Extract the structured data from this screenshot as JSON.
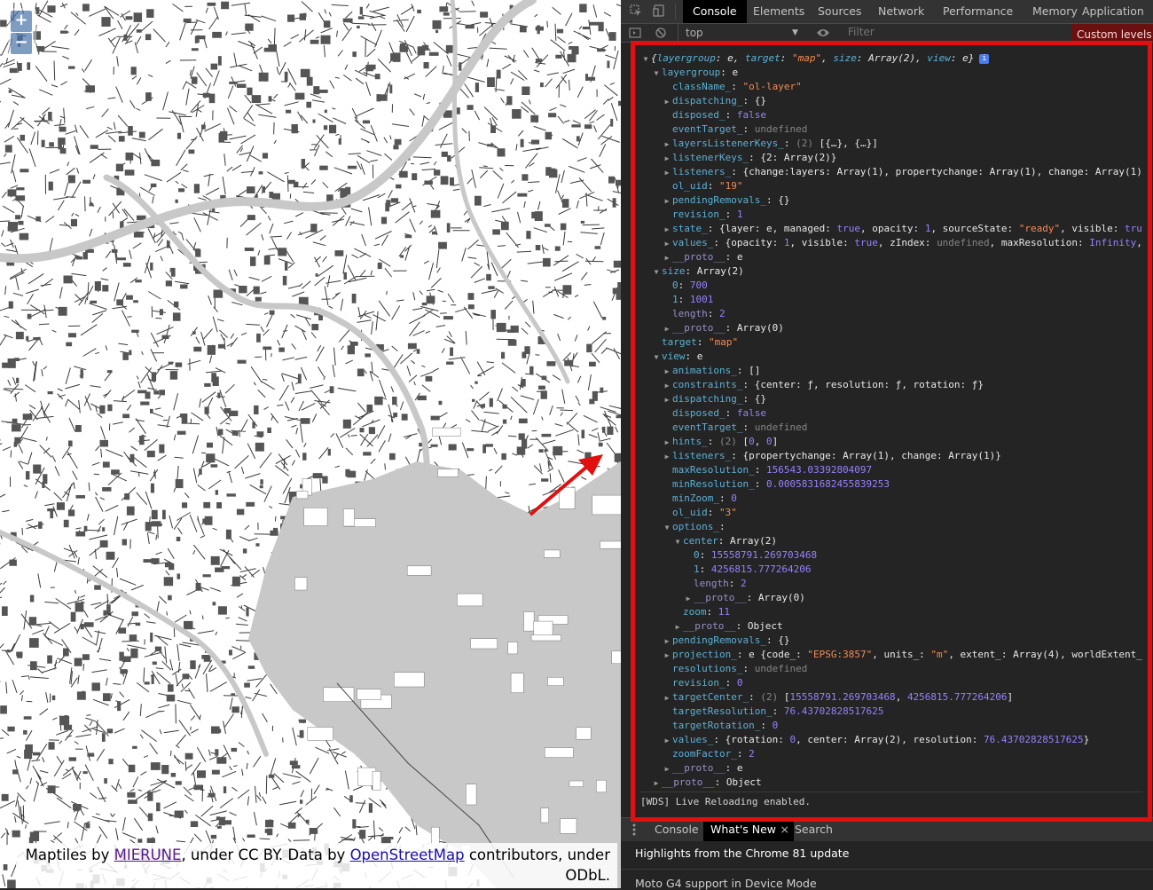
{
  "map": {
    "zoom_in": "+",
    "zoom_out": "−",
    "attribution": {
      "prefix": "Maptiles by ",
      "mierune": "MIERUNE",
      "mid": ", under CC BY. Data by ",
      "osm": "OpenStreetMap",
      "suffix": " contributors, under ODbL."
    }
  },
  "devtools": {
    "tabs": [
      "Console",
      "Elements",
      "Sources",
      "Network",
      "Performance",
      "Memory",
      "Application"
    ],
    "active_tab": "Console",
    "toolbar": {
      "context": "top",
      "filter_placeholder": "Filter",
      "levels": "Custom levels ▾"
    },
    "drawer_tabs": [
      "Console",
      "What's New",
      "Search"
    ],
    "drawer_active": "What's New",
    "drawer_close": "×",
    "drawer_headline": "Highlights from the Chrome 81 update",
    "drawer_next": "Moto G4 support in Device Mode",
    "wds_message": "[WDS] Live Reloading enabled.",
    "icons": {
      "inspect": "inspect-element-icon",
      "device": "device-toolbar-icon",
      "sidebar": "sidebar-toggle-icon",
      "clear": "clear-console-icon",
      "eye": "live-expression-icon",
      "drawer_menu": "drawer-menu-icon"
    },
    "highlight_color": "#e01010"
  },
  "console_tree": [
    {
      "indent": 0,
      "tri": "down",
      "segs": [
        [
          "p",
          "{"
        ],
        [
          "k",
          "layergroup"
        ],
        [
          "p",
          ": e, "
        ],
        [
          "k",
          "target"
        ],
        [
          "p",
          ": "
        ],
        [
          "s",
          "\"map\""
        ],
        [
          "p",
          ", "
        ],
        [
          "k",
          "size"
        ],
        [
          "p",
          ": Array(2), "
        ],
        [
          "k",
          "view"
        ],
        [
          "p",
          ": e}"
        ]
      ]
    },
    {
      "indent": 1,
      "tri": "down",
      "segs": [
        [
          "k",
          "layergroup"
        ],
        [
          "p",
          ": e"
        ]
      ]
    },
    {
      "indent": 2,
      "tri": "",
      "segs": [
        [
          "k",
          "className_"
        ],
        [
          "p",
          ": "
        ],
        [
          "s",
          "\"ol-layer\""
        ]
      ]
    },
    {
      "indent": 2,
      "tri": "right",
      "segs": [
        [
          "k",
          "dispatching_"
        ],
        [
          "p",
          ": {}"
        ]
      ]
    },
    {
      "indent": 2,
      "tri": "",
      "segs": [
        [
          "k",
          "disposed_"
        ],
        [
          "p",
          ": "
        ],
        [
          "b",
          "false"
        ]
      ]
    },
    {
      "indent": 2,
      "tri": "",
      "segs": [
        [
          "k",
          "eventTarget_"
        ],
        [
          "p",
          ": "
        ],
        [
          "u",
          "undefined"
        ]
      ]
    },
    {
      "indent": 2,
      "tri": "right",
      "segs": [
        [
          "k",
          "layersListenerKeys_"
        ],
        [
          "p",
          ": "
        ],
        [
          "u",
          "(2) "
        ],
        [
          "p",
          "[{…}, {…}]"
        ]
      ]
    },
    {
      "indent": 2,
      "tri": "right",
      "segs": [
        [
          "k",
          "listenerKeys_"
        ],
        [
          "p",
          ": {2: Array(2)}"
        ]
      ]
    },
    {
      "indent": 2,
      "tri": "right",
      "segs": [
        [
          "k",
          "listeners_"
        ],
        [
          "p",
          ": {change:layers: Array(1), propertychange: Array(1), change: Array(1)}"
        ]
      ]
    },
    {
      "indent": 2,
      "tri": "",
      "segs": [
        [
          "k",
          "ol_uid"
        ],
        [
          "p",
          ": "
        ],
        [
          "s",
          "\"19\""
        ]
      ]
    },
    {
      "indent": 2,
      "tri": "right",
      "segs": [
        [
          "k",
          "pendingRemovals_"
        ],
        [
          "p",
          ": {}"
        ]
      ]
    },
    {
      "indent": 2,
      "tri": "",
      "segs": [
        [
          "k",
          "revision_"
        ],
        [
          "p",
          ": "
        ],
        [
          "n",
          "1"
        ]
      ]
    },
    {
      "indent": 2,
      "tri": "right",
      "segs": [
        [
          "k",
          "state_"
        ],
        [
          "p",
          ": {layer: e, managed: "
        ],
        [
          "b",
          "true"
        ],
        [
          "p",
          ", opacity: "
        ],
        [
          "n",
          "1"
        ],
        [
          "p",
          ", sourceState: "
        ],
        [
          "s",
          "\"ready\""
        ],
        [
          "p",
          ", visible: "
        ],
        [
          "b",
          "true"
        ],
        [
          "p",
          ", …}"
        ]
      ]
    },
    {
      "indent": 2,
      "tri": "right",
      "segs": [
        [
          "k",
          "values_"
        ],
        [
          "p",
          ": {opacity: "
        ],
        [
          "n",
          "1"
        ],
        [
          "p",
          ", visible: "
        ],
        [
          "b",
          "true"
        ],
        [
          "p",
          ", zIndex: "
        ],
        [
          "u",
          "undefined"
        ],
        [
          "p",
          ", maxResolution: "
        ],
        [
          "n",
          "Infinity"
        ],
        [
          "p",
          ", minResolution: 0}"
        ]
      ]
    },
    {
      "indent": 2,
      "tri": "right",
      "segs": [
        [
          "k dim",
          "__proto__"
        ],
        [
          "p",
          ": e"
        ]
      ]
    },
    {
      "indent": 1,
      "tri": "down",
      "segs": [
        [
          "k",
          "size"
        ],
        [
          "p",
          ": Array(2)"
        ]
      ]
    },
    {
      "indent": 2,
      "tri": "",
      "segs": [
        [
          "k",
          "0"
        ],
        [
          "p",
          ": "
        ],
        [
          "n",
          "700"
        ]
      ]
    },
    {
      "indent": 2,
      "tri": "",
      "segs": [
        [
          "k",
          "1"
        ],
        [
          "p",
          ": "
        ],
        [
          "n",
          "1001"
        ]
      ]
    },
    {
      "indent": 2,
      "tri": "",
      "segs": [
        [
          "k dim",
          "length"
        ],
        [
          "p",
          ": "
        ],
        [
          "n",
          "2"
        ]
      ]
    },
    {
      "indent": 2,
      "tri": "right",
      "segs": [
        [
          "k dim",
          "__proto__"
        ],
        [
          "p",
          ": Array(0)"
        ]
      ]
    },
    {
      "indent": 1,
      "tri": "",
      "segs": [
        [
          "k",
          "target"
        ],
        [
          "p",
          ": "
        ],
        [
          "s",
          "\"map\""
        ]
      ]
    },
    {
      "indent": 1,
      "tri": "down",
      "segs": [
        [
          "k",
          "view"
        ],
        [
          "p",
          ": e"
        ]
      ]
    },
    {
      "indent": 2,
      "tri": "right",
      "segs": [
        [
          "k",
          "animations_"
        ],
        [
          "p",
          ": []"
        ]
      ]
    },
    {
      "indent": 2,
      "tri": "right",
      "segs": [
        [
          "k",
          "constraints_"
        ],
        [
          "p",
          ": {center: "
        ],
        [
          "p",
          "ƒ"
        ],
        [
          "p",
          ", resolution: "
        ],
        [
          "p",
          "ƒ"
        ],
        [
          "p",
          ", rotation: "
        ],
        [
          "p",
          "ƒ"
        ],
        [
          "p",
          "}"
        ]
      ]
    },
    {
      "indent": 2,
      "tri": "right",
      "segs": [
        [
          "k",
          "dispatching_"
        ],
        [
          "p",
          ": {}"
        ]
      ]
    },
    {
      "indent": 2,
      "tri": "",
      "segs": [
        [
          "k",
          "disposed_"
        ],
        [
          "p",
          ": "
        ],
        [
          "b",
          "false"
        ]
      ]
    },
    {
      "indent": 2,
      "tri": "",
      "segs": [
        [
          "k",
          "eventTarget_"
        ],
        [
          "p",
          ": "
        ],
        [
          "u",
          "undefined"
        ]
      ]
    },
    {
      "indent": 2,
      "tri": "right",
      "segs": [
        [
          "k",
          "hints_"
        ],
        [
          "p",
          ": "
        ],
        [
          "u",
          "(2) "
        ],
        [
          "p",
          "["
        ],
        [
          "n",
          "0"
        ],
        [
          "p",
          ", "
        ],
        [
          "n",
          "0"
        ],
        [
          "p",
          "]"
        ]
      ]
    },
    {
      "indent": 2,
      "tri": "right",
      "segs": [
        [
          "k",
          "listeners_"
        ],
        [
          "p",
          ": {propertychange: Array(1), change: Array(1)}"
        ]
      ]
    },
    {
      "indent": 2,
      "tri": "",
      "segs": [
        [
          "k",
          "maxResolution_"
        ],
        [
          "p",
          ": "
        ],
        [
          "n",
          "156543.03392804097"
        ]
      ]
    },
    {
      "indent": 2,
      "tri": "",
      "segs": [
        [
          "k",
          "minResolution_"
        ],
        [
          "p",
          ": "
        ],
        [
          "n",
          "0.0005831682455839253"
        ]
      ]
    },
    {
      "indent": 2,
      "tri": "",
      "segs": [
        [
          "k",
          "minZoom_"
        ],
        [
          "p",
          ": "
        ],
        [
          "n",
          "0"
        ]
      ]
    },
    {
      "indent": 2,
      "tri": "",
      "segs": [
        [
          "k",
          "ol_uid"
        ],
        [
          "p",
          ": "
        ],
        [
          "s",
          "\"3\""
        ]
      ]
    },
    {
      "indent": 2,
      "tri": "down",
      "segs": [
        [
          "k",
          "options_"
        ],
        [
          "p",
          ":"
        ]
      ]
    },
    {
      "indent": 3,
      "tri": "down",
      "segs": [
        [
          "k",
          "center"
        ],
        [
          "p",
          ": Array(2)"
        ]
      ]
    },
    {
      "indent": 4,
      "tri": "",
      "segs": [
        [
          "k",
          "0"
        ],
        [
          "p",
          ": "
        ],
        [
          "n",
          "15558791.269703468"
        ]
      ]
    },
    {
      "indent": 4,
      "tri": "",
      "segs": [
        [
          "k",
          "1"
        ],
        [
          "p",
          ": "
        ],
        [
          "n",
          "4256815.777264206"
        ]
      ]
    },
    {
      "indent": 4,
      "tri": "",
      "segs": [
        [
          "k dim",
          "length"
        ],
        [
          "p",
          ": "
        ],
        [
          "n",
          "2"
        ]
      ]
    },
    {
      "indent": 4,
      "tri": "right",
      "segs": [
        [
          "k dim",
          "__proto__"
        ],
        [
          "p",
          ": Array(0)"
        ]
      ]
    },
    {
      "indent": 3,
      "tri": "",
      "segs": [
        [
          "k",
          "zoom"
        ],
        [
          "p",
          ": "
        ],
        [
          "n",
          "11"
        ]
      ]
    },
    {
      "indent": 3,
      "tri": "right",
      "segs": [
        [
          "k dim",
          "__proto__"
        ],
        [
          "p",
          ": Object"
        ]
      ]
    },
    {
      "indent": 2,
      "tri": "right",
      "segs": [
        [
          "k",
          "pendingRemovals_"
        ],
        [
          "p",
          ": {}"
        ]
      ]
    },
    {
      "indent": 2,
      "tri": "right",
      "segs": [
        [
          "k",
          "projection_"
        ],
        [
          "p",
          ": e {code_: "
        ],
        [
          "s",
          "\"EPSG:3857\""
        ],
        [
          "p",
          ", units_: "
        ],
        [
          "s",
          "\"m\""
        ],
        [
          "p",
          ", extent_: Array(4), worldExtent_: Array(4)…}"
        ]
      ]
    },
    {
      "indent": 2,
      "tri": "",
      "segs": [
        [
          "k",
          "resolutions_"
        ],
        [
          "p",
          ": "
        ],
        [
          "u",
          "undefined"
        ]
      ]
    },
    {
      "indent": 2,
      "tri": "",
      "segs": [
        [
          "k",
          "revision_"
        ],
        [
          "p",
          ": "
        ],
        [
          "n",
          "0"
        ]
      ]
    },
    {
      "indent": 2,
      "tri": "right",
      "segs": [
        [
          "k",
          "targetCenter_"
        ],
        [
          "p",
          ": "
        ],
        [
          "u",
          "(2) "
        ],
        [
          "p",
          "["
        ],
        [
          "n",
          "15558791.269703468"
        ],
        [
          "p",
          ", "
        ],
        [
          "n",
          "4256815.777264206"
        ],
        [
          "p",
          "]"
        ]
      ]
    },
    {
      "indent": 2,
      "tri": "",
      "segs": [
        [
          "k",
          "targetResolution_"
        ],
        [
          "p",
          ": "
        ],
        [
          "n",
          "76.43702828517625"
        ]
      ]
    },
    {
      "indent": 2,
      "tri": "",
      "segs": [
        [
          "k",
          "targetRotation_"
        ],
        [
          "p",
          ": "
        ],
        [
          "n",
          "0"
        ]
      ]
    },
    {
      "indent": 2,
      "tri": "right",
      "segs": [
        [
          "k",
          "values_"
        ],
        [
          "p",
          ": {rotation: "
        ],
        [
          "n",
          "0"
        ],
        [
          "p",
          ", center: Array(2), resolution: "
        ],
        [
          "n",
          "76.43702828517625"
        ],
        [
          "p",
          "}"
        ]
      ]
    },
    {
      "indent": 2,
      "tri": "",
      "segs": [
        [
          "k",
          "zoomFactor_"
        ],
        [
          "p",
          ": "
        ],
        [
          "n",
          "2"
        ]
      ]
    },
    {
      "indent": 2,
      "tri": "right",
      "segs": [
        [
          "k dim",
          "__proto__"
        ],
        [
          "p",
          ": e"
        ]
      ]
    },
    {
      "indent": 1,
      "tri": "right",
      "segs": [
        [
          "k dim",
          "__proto__"
        ],
        [
          "p",
          ": Object"
        ]
      ]
    }
  ]
}
